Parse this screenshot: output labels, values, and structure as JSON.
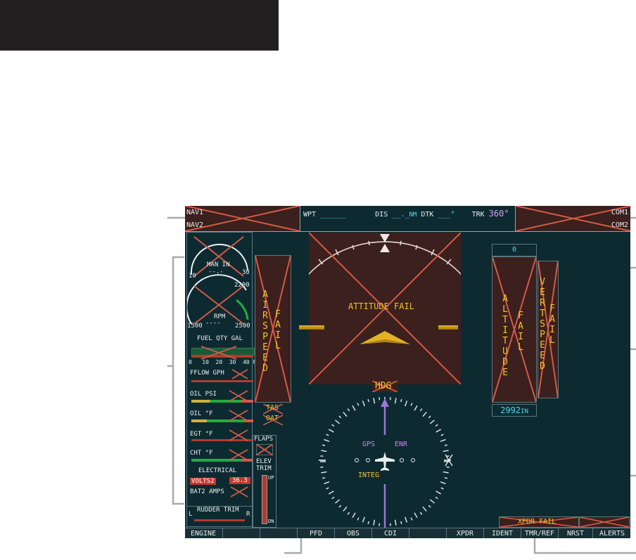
{
  "header_nav": {
    "nav1": "NAV1",
    "nav2": "NAV2",
    "wpt_label": "WPT",
    "wpt_value": "______",
    "dis_label": "DIS",
    "dis_value": "__._",
    "dis_unit": "NM",
    "dtk_label": "DTK",
    "dtk_value": "___",
    "dtk_unit": "°",
    "trk_label": "TRK",
    "trk_value": "360°",
    "com1": "COM1",
    "com2": "COM2"
  },
  "engine": {
    "map_label": "MAN IN",
    "map_dash": "--.-",
    "map_min": "10",
    "map_max": "30",
    "rpm_label": "RPM",
    "rpm_dash": "----",
    "rpm_mid": "2200",
    "rpm_min": "1500",
    "rpm_max": "2500",
    "fuel_label": "FUEL QTY GAL",
    "fuel_scale": "0   10  20  30  40 F",
    "fflow_label": "FFLOW GPH",
    "oilpsi_label": "OIL PSI",
    "oilf_label": "OIL °F",
    "egt_label": "EGT °F",
    "cht_label": "CHT °F",
    "elec_label": "ELECTRICAL",
    "volts_label": "VOLTS2",
    "volts_value": "36.3",
    "bat_label": "BAT2 AMPS",
    "rudder_label": "RUDDER TRIM",
    "rudder_l": "L",
    "rudder_r": "R"
  },
  "flaps": {
    "label": "FLAPS",
    "elev_line1": "ELEV",
    "elev_line2": "TRIM",
    "up": "UP",
    "dn": "DN"
  },
  "pfd": {
    "airspeed_fail": "AIRSPEED",
    "fail": "FAIL",
    "tas": "TAS",
    "oat": "OAT",
    "attitude_fail": "ATTITUDE FAIL",
    "hdg": "HDG",
    "altitude_fail": "ALTITUDE",
    "alt_fail": "FAIL",
    "vert_speed": "VERT SPEED",
    "vs_fail": "FAIL",
    "selected_alt": "0",
    "baro": "2992",
    "baro_unit": "IN",
    "gps": "GPS",
    "enr": "ENR",
    "integ": "INTEG",
    "xpdr_fail": "XPDR FAIL"
  },
  "softkeys": [
    "ENGINE",
    "",
    "",
    "PFD",
    "OBS",
    "CDI",
    "",
    "XPDR",
    "IDENT",
    "TMR/REF",
    "NRST",
    "ALERTS"
  ],
  "colors": {
    "background": "#0e2a31",
    "fail_red": "#d55a46",
    "fail_fill": "#3b201d",
    "amber": "#f2c42a",
    "cyan": "#4fd8ec",
    "magenta": "#d59cff",
    "callout": "#a7a9ac"
  }
}
